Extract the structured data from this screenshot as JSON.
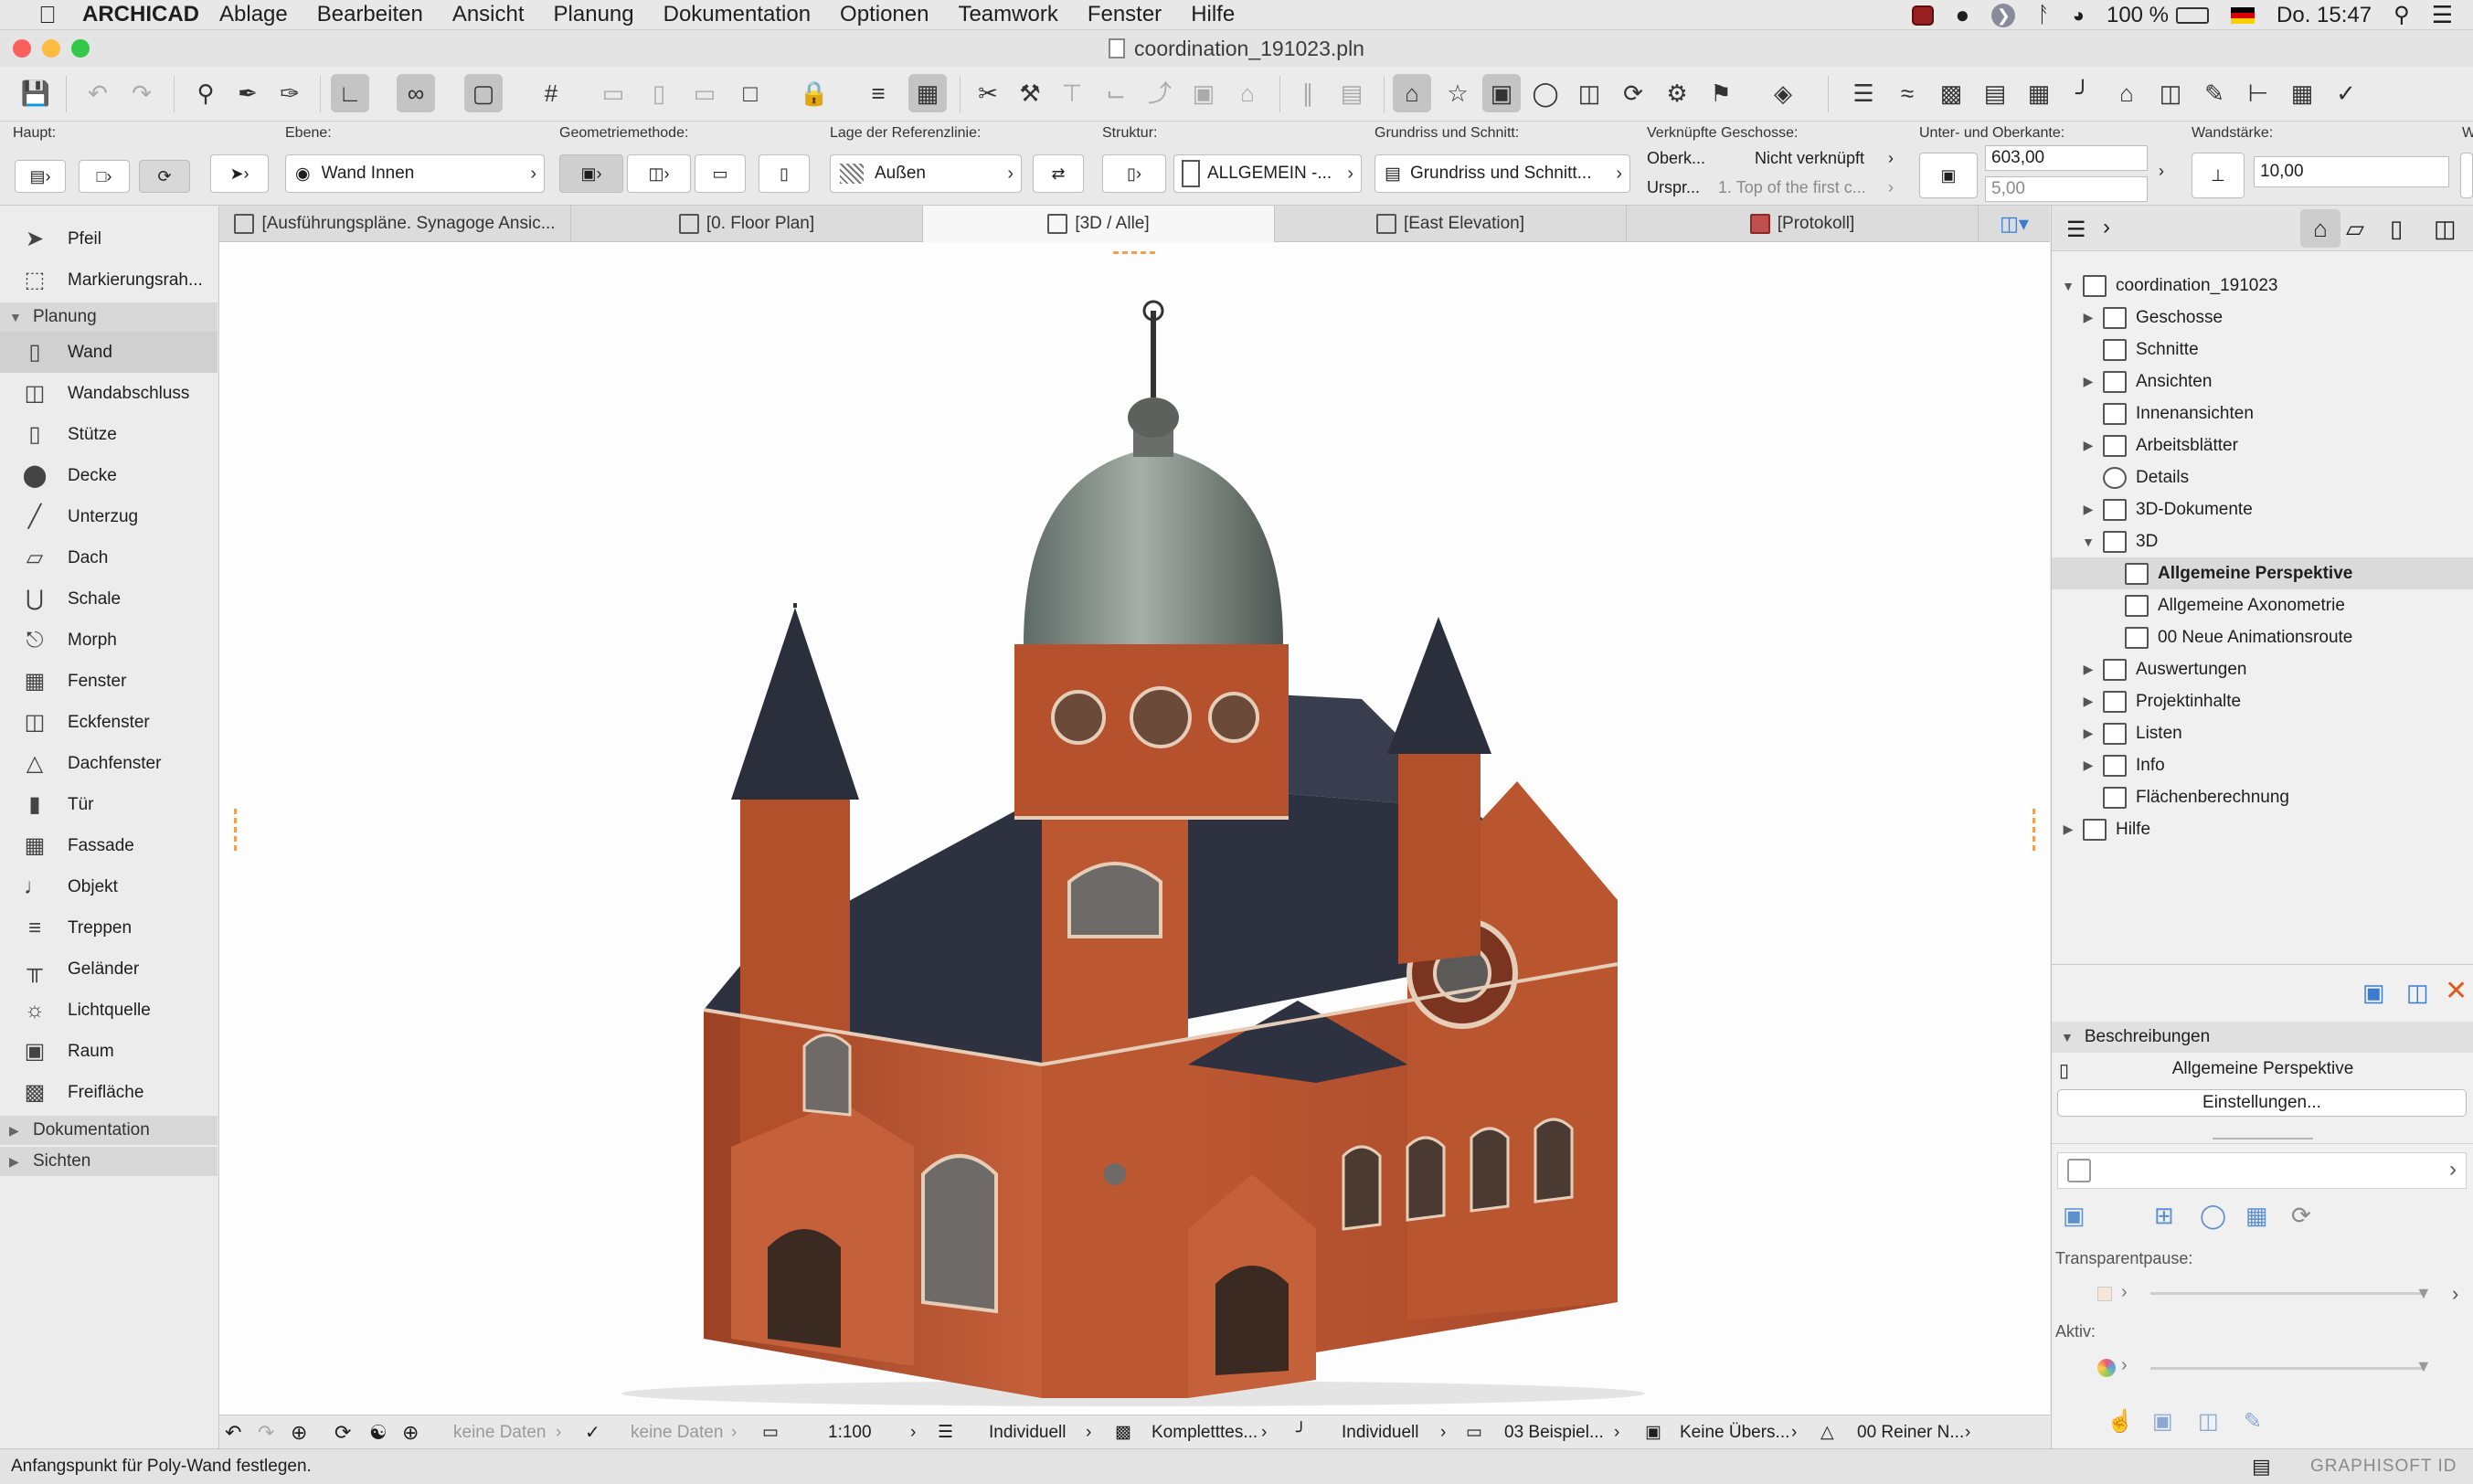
{
  "menubar": {
    "app_name": "ARCHICAD",
    "items": [
      "Ablage",
      "Bearbeiten",
      "Ansicht",
      "Planung",
      "Dokumentation",
      "Optionen",
      "Teamwork",
      "Fenster",
      "Hilfe"
    ],
    "battery": "100 %",
    "clock": "Do. 15:47"
  },
  "window": {
    "title": "coordination_191023.pln"
  },
  "infobox": {
    "haupt_label": "Haupt:",
    "ebene_label": "Ebene:",
    "ebene_value": "Wand Innen",
    "geometrie_label": "Geometriemethode:",
    "referenz_label": "Lage der Referenzlinie:",
    "referenz_value": "Außen",
    "struktur_label": "Struktur:",
    "struktur_value": "ALLGEMEIN -...",
    "grundriss_label": "Grundriss und Schnitt:",
    "grundriss_value": "Grundriss und Schnitt...",
    "geschosse_label": "Verknüpfte Geschosse:",
    "oberk_label": "Oberk...",
    "oberk_value": "Nicht verknüpft",
    "urspr_label": "Urspr...",
    "urspr_value": "1. Top of the first c...",
    "kante_label": "Unter- und Oberkante:",
    "kante_top": "603,00",
    "kante_bottom": "5,00",
    "staerke_label": "Wandstärke:",
    "staerke_value": "10,00",
    "extra_label": "W"
  },
  "tabs": [
    {
      "label": "[Ausführungspläne. Synagoge Ansic..."
    },
    {
      "label": "[0. Floor Plan]"
    },
    {
      "label": "[3D / Alle]"
    },
    {
      "label": "[East Elevation]"
    },
    {
      "label": "[Protokoll]"
    }
  ],
  "toolbox": {
    "pfeil": "Pfeil",
    "markierung": "Markierungsrah...",
    "section_planung": "Planung",
    "tools": [
      "Wand",
      "Wandabschluss",
      "Stütze",
      "Decke",
      "Unterzug",
      "Dach",
      "Schale",
      "Morph",
      "Fenster",
      "Eckfenster",
      "Dachfenster",
      "Tür",
      "Fassade",
      "Objekt",
      "Treppen",
      "Geländer",
      "Lichtquelle",
      "Raum",
      "Freifläche"
    ],
    "section_dokumentation": "Dokumentation",
    "section_sichten": "Sichten"
  },
  "bottombar": {
    "keine_daten_1": "keine Daten",
    "keine_daten_2": "keine Daten",
    "scale": "1:100",
    "layer": "Individuell",
    "model": "Kompletttes...",
    "pen": "Individuell",
    "renovation": "03 Beispiel...",
    "graphic_override": "Keine Übers...",
    "partial": "00 Reiner N..."
  },
  "statusbar": {
    "hint": "Anfangspunkt für Poly-Wand festlegen.",
    "brand": "GRAPHISOFT ID"
  },
  "navigator": {
    "root": "coordination_191023",
    "items": [
      {
        "label": "Geschosse"
      },
      {
        "label": "Schnitte"
      },
      {
        "label": "Ansichten"
      },
      {
        "label": "Innenansichten"
      },
      {
        "label": "Arbeitsblätter"
      },
      {
        "label": "Details"
      },
      {
        "label": "3D-Dokumente"
      },
      {
        "label": "3D"
      },
      {
        "label": "Allgemeine Perspektive"
      },
      {
        "label": "Allgemeine Axonometrie"
      },
      {
        "label": "00 Neue Animationsroute"
      },
      {
        "label": "Auswertungen"
      },
      {
        "label": "Projektinhalte"
      },
      {
        "label": "Listen"
      },
      {
        "label": "Info"
      },
      {
        "label": "Flächenberechnung"
      },
      {
        "label": "Hilfe"
      }
    ],
    "beschreibungen": "Beschreibungen",
    "selected_view": "Allgemeine Perspektive",
    "settings_button": "Einstellungen...",
    "transparent_label": "Transparentpause:",
    "aktiv_label": "Aktiv:"
  },
  "colors": {
    "brick": "#b8532e",
    "roof": "#2e3140",
    "dome": "#7f8a86",
    "accent_orange": "#f0a050"
  }
}
